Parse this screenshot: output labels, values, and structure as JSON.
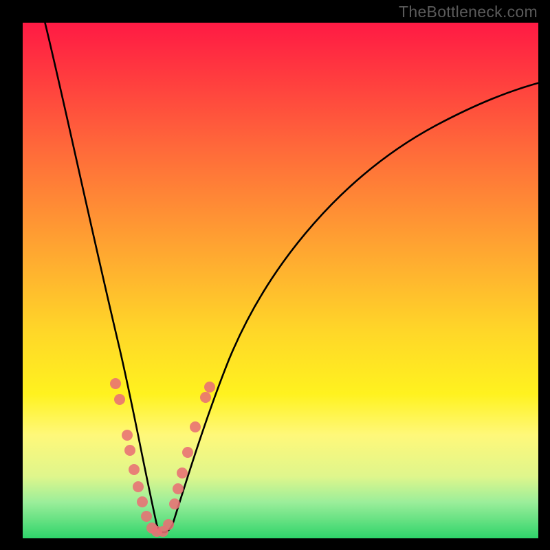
{
  "watermark": "TheBottleneck.com",
  "chart_data": {
    "type": "line",
    "title": "",
    "xlabel": "",
    "ylabel": "",
    "xlim": [
      0,
      100
    ],
    "ylim": [
      0,
      100
    ],
    "series": [
      {
        "name": "bottleneck-curve",
        "description": "V-shaped curve; high on both sides, minimum near x≈25",
        "points": [
          {
            "x": 4,
            "y": 100
          },
          {
            "x": 6,
            "y": 90
          },
          {
            "x": 10,
            "y": 70
          },
          {
            "x": 15,
            "y": 45
          },
          {
            "x": 19,
            "y": 25
          },
          {
            "x": 22,
            "y": 10
          },
          {
            "x": 24,
            "y": 3
          },
          {
            "x": 26,
            "y": 1
          },
          {
            "x": 28,
            "y": 3
          },
          {
            "x": 31,
            "y": 12
          },
          {
            "x": 36,
            "y": 28
          },
          {
            "x": 45,
            "y": 48
          },
          {
            "x": 60,
            "y": 67
          },
          {
            "x": 80,
            "y": 80
          },
          {
            "x": 100,
            "y": 87
          }
        ]
      }
    ],
    "scatter_overlay": {
      "name": "highlight-dots",
      "color": "#e87074",
      "points": [
        {
          "x": 18.0,
          "y": 30
        },
        {
          "x": 18.8,
          "y": 27
        },
        {
          "x": 20.2,
          "y": 20
        },
        {
          "x": 20.8,
          "y": 17
        },
        {
          "x": 21.6,
          "y": 13
        },
        {
          "x": 22.4,
          "y": 10
        },
        {
          "x": 23.2,
          "y": 7
        },
        {
          "x": 24.0,
          "y": 4
        },
        {
          "x": 25.0,
          "y": 2
        },
        {
          "x": 25.8,
          "y": 1.5
        },
        {
          "x": 26.8,
          "y": 1.5
        },
        {
          "x": 27.8,
          "y": 3
        },
        {
          "x": 29.2,
          "y": 7
        },
        {
          "x": 30.0,
          "y": 10
        },
        {
          "x": 30.8,
          "y": 13
        },
        {
          "x": 31.8,
          "y": 17
        },
        {
          "x": 33.2,
          "y": 22
        },
        {
          "x": 35.2,
          "y": 28
        },
        {
          "x": 36.0,
          "y": 30
        }
      ]
    }
  }
}
